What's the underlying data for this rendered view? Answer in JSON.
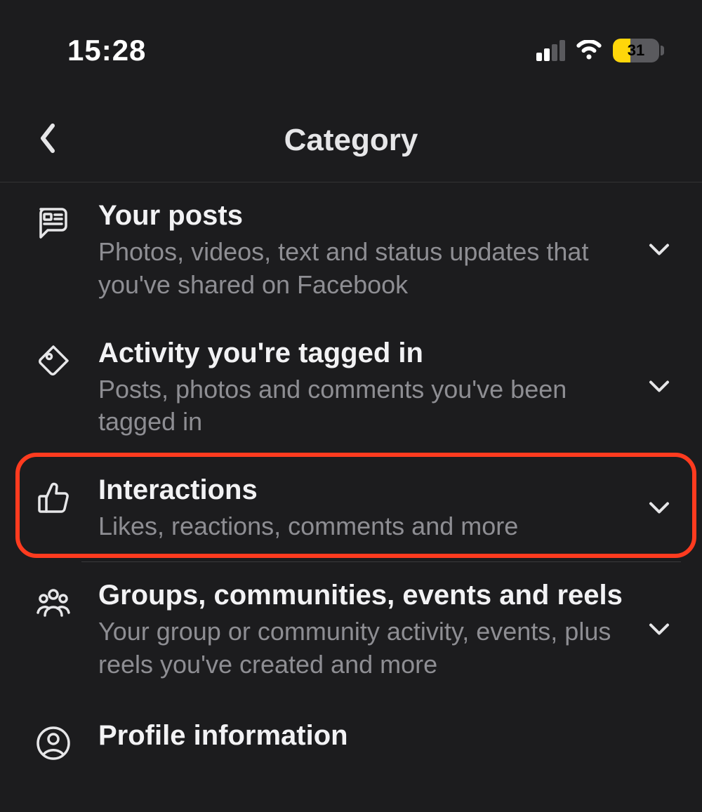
{
  "statusbar": {
    "time": "15:28",
    "battery": "31"
  },
  "header": {
    "title": "Category"
  },
  "list": [
    {
      "title": "Your posts",
      "sub": "Photos, videos, text and status updates that you've shared on Facebook"
    },
    {
      "title": "Activity you're tagged in",
      "sub": "Posts, photos and comments you've been tagged in"
    },
    {
      "title": "Interactions",
      "sub": "Likes, reactions, comments and more"
    },
    {
      "title": "Groups, communities, events and reels",
      "sub": "Your group or community activity, events, plus reels you've created and more"
    },
    {
      "title": "Profile information",
      "sub": ""
    }
  ]
}
